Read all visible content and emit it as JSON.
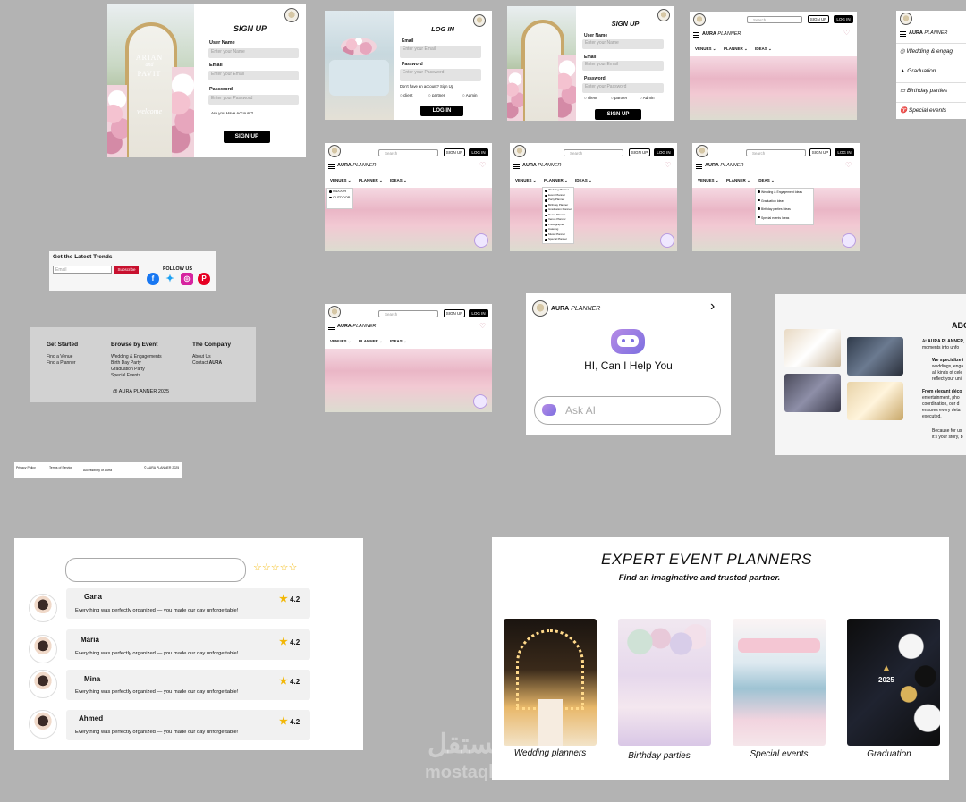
{
  "brand": {
    "name_bold": "AURA",
    "name_rest": "PLANNER"
  },
  "signup1": {
    "title": "SIGN UP",
    "username_label": "User Name",
    "username_ph": "Enter your Name",
    "email_label": "Email",
    "email_ph": "Enter your Email",
    "password_label": "Password",
    "password_ph": "Enter your Password",
    "have_account": "Are you Have Account?",
    "button": "SIGN UP",
    "sign_line1": "ARIAN",
    "sign_line2": "and",
    "sign_line3": "PAVIT",
    "sign_welcome": "welcome"
  },
  "login": {
    "title": "LOG IN",
    "email_label": "Email",
    "email_ph": "Enter your Email",
    "password_label": "Password",
    "password_ph": "Enter your Password",
    "no_account": "Don't have an account? Sign Up",
    "roles": [
      "client",
      "partner",
      "Admin"
    ],
    "button": "LOG IN"
  },
  "signup2": {
    "title": "SIGN UP",
    "username_label": "User Name",
    "username_ph": "Enter your Name",
    "email_label": "Email",
    "email_ph": "Enter your Email",
    "password_label": "Password",
    "password_ph": "Enter your Password",
    "roles": [
      "client",
      "partner",
      "Admin"
    ],
    "button": "SIGN UP"
  },
  "header": {
    "search_ph": "Search",
    "signup": "SIGN UP",
    "login": "LOG IN",
    "menu": [
      "VENUES",
      "PLANNER",
      "IDEAS"
    ]
  },
  "side_menu": {
    "items": [
      "Wedding & engag",
      "Graduation",
      "Birthday parties",
      "Special events"
    ]
  },
  "venues_dropdown": [
    "INDOOR",
    "OUTDOOR"
  ],
  "planner_dropdown": [
    "Wedding Planner",
    "Event Planner",
    "Party Planner",
    "Birthday Planner",
    "Graduation Planner",
    "Decor Planner",
    "Venue Planner",
    "Photographer",
    "Catering",
    "Music Planner",
    "Special Planner"
  ],
  "ideas_dropdown": [
    "Wedding & Engagement Ideas",
    "Graduation Ideas",
    "Birthday parties Ideas",
    "Special events Ideas"
  ],
  "newsletter": {
    "title": "Get the Latest Trends",
    "email_ph": "Email",
    "subscribe": "Subscribe",
    "follow": "FOLLOW US"
  },
  "footer": {
    "col1_title": "Get Started",
    "col1": [
      "Find a Venue",
      "Find a Planner"
    ],
    "col2_title": "Browse by Event",
    "col2": [
      "Wedding & Engagements",
      "Birth Day Party",
      "Graduation Party",
      "Special Events"
    ],
    "col3_title": "The Company",
    "col3_about": "About Us",
    "col3_contact_pre": "Contact ",
    "col3_contact_brand": "AURA",
    "copyright": "@ AURA PLANNER 2025"
  },
  "legal": {
    "privacy": "Privacy Policy",
    "terms": "Terms of Service",
    "accessibility": "Accessibility of Aurfa",
    "copyright": "© AURA PLANNER 2025"
  },
  "assistant": {
    "greeting": "HI, Can I Help You",
    "ask_ph": "Ask AI"
  },
  "about": {
    "title": "ABO",
    "p1_pre": "At ",
    "p1_brand": "AURA PLANNER,",
    "p1_rest": "moments into unfo",
    "p2": "We specialize i",
    "p3": "weddings, enga",
    "p4": "all kinds of cele",
    "p5": "reflect your uni",
    "p6": "From elegant déco",
    "p7": "entertainment, pho",
    "p8": "coordination, our d",
    "p9": "ensures every deta",
    "p10": "executed.",
    "p11": "Because for us",
    "p12": "it's your story, b"
  },
  "reviews": {
    "items": [
      {
        "name": "Gana",
        "rating": "4.2",
        "text": "Everything was perfectly organized — you made our day unforgettable!"
      },
      {
        "name": "Maria",
        "rating": "4.2",
        "text": "Everything was perfectly organized — you made our day unforgettable!"
      },
      {
        "name": "Mina",
        "rating": "4.2",
        "text": "Everything was perfectly organized — you made our day unforgettable!"
      },
      {
        "name": "Ahmed",
        "rating": "4.2",
        "text": "Everything was perfectly organized — you made our day unforgettable!"
      }
    ],
    "empty_stars": "☆☆☆☆☆"
  },
  "experts": {
    "title": "EXPERT EVENT PLANNERS",
    "subtitle": "Find an imaginative and trusted partner.",
    "categories": [
      "Wedding planners",
      "Birthday parties",
      "Special events",
      "Graduation"
    ],
    "grad_year": "2025"
  },
  "watermark": {
    "ar": "مستقل",
    "en": "mostaql.com"
  },
  "colors": {
    "accent_red": "#c8102e",
    "star": "#f2b705",
    "page_bg": "#b3b3b3"
  }
}
